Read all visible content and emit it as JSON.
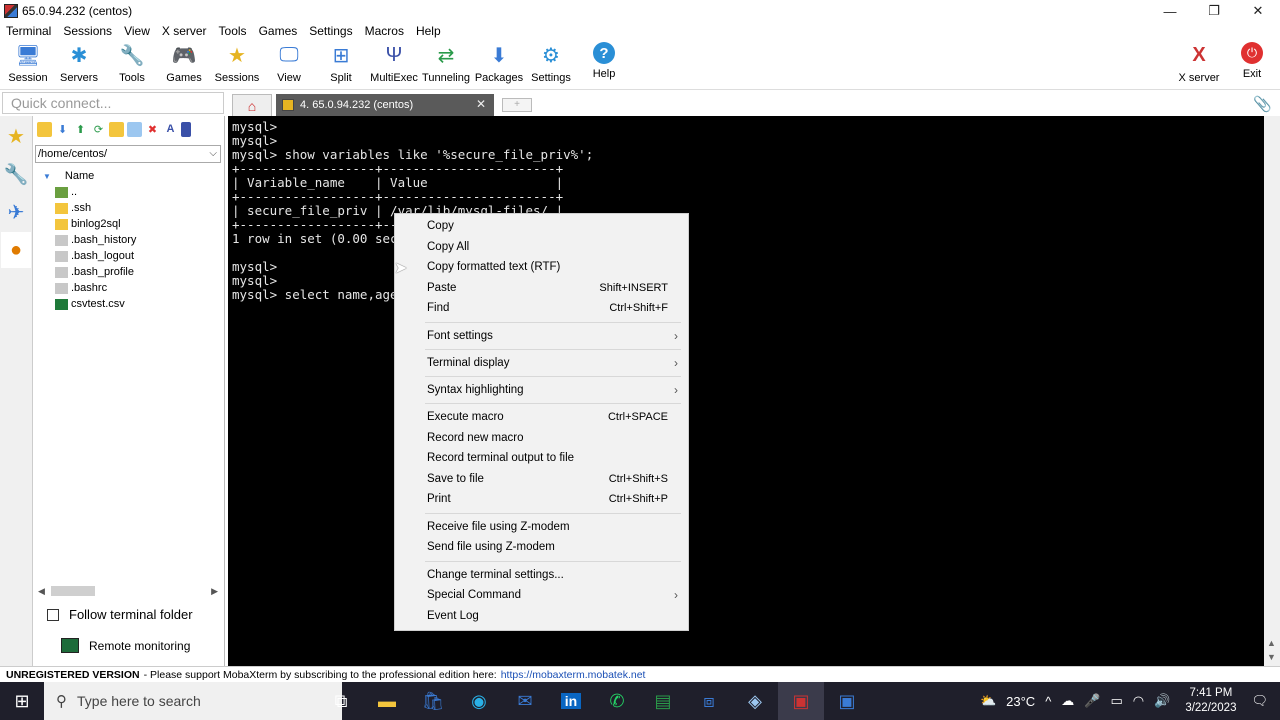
{
  "window": {
    "title": "65.0.94.232 (centos)",
    "controls": [
      "minimize-icon",
      "restore-icon",
      "close-icon"
    ]
  },
  "menubar": [
    "Terminal",
    "Sessions",
    "View",
    "X server",
    "Tools",
    "Games",
    "Settings",
    "Macros",
    "Help"
  ],
  "toolbar": {
    "left": [
      "Session",
      "Servers",
      "Tools",
      "Games",
      "Sessions",
      "View",
      "Split",
      "MultiExec",
      "Tunneling",
      "Packages",
      "Settings",
      "Help"
    ],
    "right": [
      "X server",
      "Exit"
    ]
  },
  "quick_connect": {
    "placeholder": "Quick connect..."
  },
  "tabs": {
    "session_label": "4. 65.0.94.232 (centos)"
  },
  "sftp": {
    "path": "/home/centos/",
    "column": "Name",
    "items": [
      "..",
      ".ssh",
      "binlog2sql",
      ".bash_history",
      ".bash_logout",
      ".bash_profile",
      ".bashrc",
      "csvtest.csv"
    ],
    "follow_label": "Follow terminal folder",
    "remote_label": "Remote monitoring"
  },
  "terminal": {
    "lines": [
      "mysql>",
      "mysql>",
      "mysql> show variables like '%secure_file_priv%';",
      "+------------------+-----------------------+",
      "| Variable_name    | Value                 |",
      "+------------------+-----------------------+",
      "| secure_file_priv | /var/lib/mysql-files/ |",
      "+------------------+-----------------------+",
      "1 row in set (0.00 sec)",
      "",
      "mysql>",
      "mysql>",
      "mysql> select name,age"
    ]
  },
  "context_menu": {
    "items": [
      {
        "label": "Copy",
        "shortcut": ""
      },
      {
        "label": "Copy All",
        "shortcut": ""
      },
      {
        "label": "Copy formatted text (RTF)",
        "shortcut": ""
      },
      {
        "label": "Paste",
        "shortcut": "Shift+INSERT"
      },
      {
        "label": "Find",
        "shortcut": "Ctrl+Shift+F"
      },
      {
        "label": "Font settings",
        "shortcut": "›"
      },
      {
        "label": "Terminal display",
        "shortcut": "›"
      },
      {
        "label": "Syntax highlighting",
        "shortcut": "›"
      },
      {
        "label": "Execute macro",
        "shortcut": "Ctrl+SPACE"
      },
      {
        "label": "Record new macro",
        "shortcut": ""
      },
      {
        "label": "Record terminal output to file",
        "shortcut": ""
      },
      {
        "label": "Save to file",
        "shortcut": "Ctrl+Shift+S"
      },
      {
        "label": "Print",
        "shortcut": "Ctrl+Shift+P"
      },
      {
        "label": "Receive file using Z-modem",
        "shortcut": ""
      },
      {
        "label": "Send file using Z-modem",
        "shortcut": ""
      },
      {
        "label": "Change terminal settings...",
        "shortcut": ""
      },
      {
        "label": "Special Command",
        "shortcut": "›"
      },
      {
        "label": "Event Log",
        "shortcut": ""
      }
    ]
  },
  "statusbar": {
    "unregistered": "UNREGISTERED VERSION",
    "message": "-  Please support MobaXterm by subscribing to the professional edition here:",
    "link": "https://mobaxterm.mobatek.net"
  },
  "taskbar": {
    "search_placeholder": "Type here to search",
    "weather": "23°C",
    "time": "7:41 PM",
    "date": "3/22/2023"
  },
  "colors": {
    "accent": "#3a7bd5",
    "terminal_bg": "#000000",
    "taskbar_bg": "#1f1f2b"
  }
}
